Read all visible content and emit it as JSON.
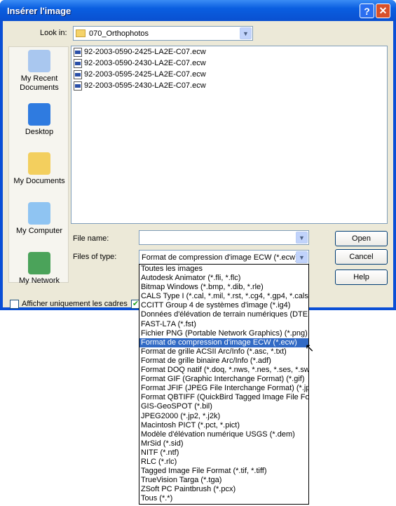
{
  "window": {
    "title": "Insérer l'image",
    "help_label": "?",
    "close_label": "✕"
  },
  "toolbar": {
    "look_in_label": "Look in:",
    "look_in_value": "070_Orthophotos",
    "icons": [
      "back-icon",
      "up-folder-icon",
      "new-folder-icon",
      "views-menu-icon"
    ]
  },
  "places": [
    {
      "label": "My Recent Documents"
    },
    {
      "label": "Desktop"
    },
    {
      "label": "My Documents"
    },
    {
      "label": "My Computer"
    },
    {
      "label": "My Network"
    }
  ],
  "files": [
    "92-2003-0590-2425-LA2E-C07.ecw",
    "92-2003-0590-2430-LA2E-C07.ecw",
    "92-2003-0595-2425-LA2E-C07.ecw",
    "92-2003-0595-2430-LA2E-C07.ecw"
  ],
  "form": {
    "file_name_label": "File name:",
    "file_name_value": "",
    "files_of_type_label": "Files of type:",
    "files_of_type_value": "Format de compression d'image ECW (*.ecw)"
  },
  "buttons": {
    "open": "Open",
    "cancel": "Cancel",
    "help": "Help"
  },
  "options": {
    "frames_only_label": "Afficher uniquement les cadres",
    "frames_only_checked": false,
    "second_checked": true
  },
  "type_list": {
    "selected_index": 8,
    "items": [
      "Toutes les images",
      "Autodesk Animator (*.fli, *.flc)",
      "Bitmap Windows (*.bmp, *.dib, *.rle)",
      "CALS Type I (*.cal, *.mil, *.rst, *.cg4, *.gp4, *.cals)",
      "CCITT Group 4 de systèmes d'image (*.ig4)",
      "Données d'élévation de terrain numériques (DTED -",
      "FAST-L7A (*.fst)",
      "Fichier PNG (Portable Network Graphics) (*.png)",
      "Format de compression d'image ECW (*.ecw)",
      "Format de grille ACSII Arc/Info (*.asc, *.txt)",
      "Format de grille binaire Arc/Info (*.adf)",
      "Format DOQ natif (*.doq, *.nws, *.nes, *.ses, *.sws)",
      "Format GIF (Graphic Interchange Format) (*.gif)",
      "Format JFIF (JPEG File Interchange Format) (*.jpg, *",
      "Format QBTIFF (QuickBird Tagged Image File Form",
      "GIS-GeoSPOT (*.bil)",
      "JPEG2000 (*.jp2, *.j2k)",
      "Macintosh PICT (*.pct, *.pict)",
      "Modèle d'élévation numérique USGS (*.dem)",
      "MrSid (*.sid)",
      "NITF (*.ntf)",
      "RLC (*.rlc)",
      "Tagged Image File Format (*.tif, *.tiff)",
      "TrueVision Targa (*.tga)",
      "ZSoft PC Paintbrush (*.pcx)",
      "Tous (*.*)"
    ]
  }
}
